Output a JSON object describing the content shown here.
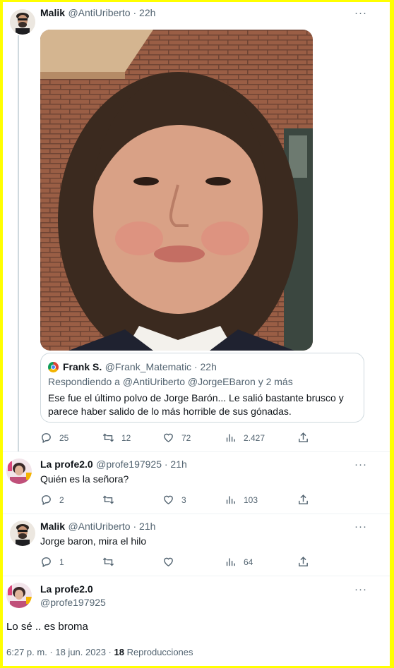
{
  "tweet1": {
    "name": "Malik",
    "handle_time": "@AntiUriberto · 22h",
    "quote": {
      "name": "Frank S.",
      "handle_time": "@Frank_Matematic · 22h",
      "replying": "Respondiendo a @AntiUriberto @JorgeEBaron y 2 más",
      "text_line1": "Ese fue el último polvo de Jorge Barón... Le salió bastante brusco y",
      "text_line2": "parece haber salido de lo más horrible de sus gónadas."
    },
    "stats": {
      "replies": "25",
      "retweets": "12",
      "likes": "72",
      "views": "2.427"
    }
  },
  "tweet2": {
    "name": "La profe2.0",
    "handle_time": "@profe197925 · 21h",
    "text": "Quién es la señora?",
    "stats": {
      "replies": "2",
      "retweets": "",
      "likes": "3",
      "views": "103"
    }
  },
  "tweet3": {
    "name": "Malik",
    "handle_time": "@AntiUriberto · 21h",
    "text": "Jorge baron, mira el hilo",
    "stats": {
      "replies": "1",
      "retweets": "",
      "likes": "",
      "views": "64"
    }
  },
  "main": {
    "name": "La profe2.0",
    "handle": "@profe197925",
    "text": "Lo sé .. es broma",
    "timestamp": "6:27 p. m. · 18 jun. 2023 · ",
    "views_count": "18",
    "views_label": " Reproducciones"
  },
  "colors": {
    "frame": "#ffff00",
    "secondary_text": "#536471",
    "thread_line": "#cfd9de"
  },
  "icons": [
    "reply-icon",
    "retweet-icon",
    "like-icon",
    "views-icon",
    "share-icon",
    "more-icon"
  ]
}
